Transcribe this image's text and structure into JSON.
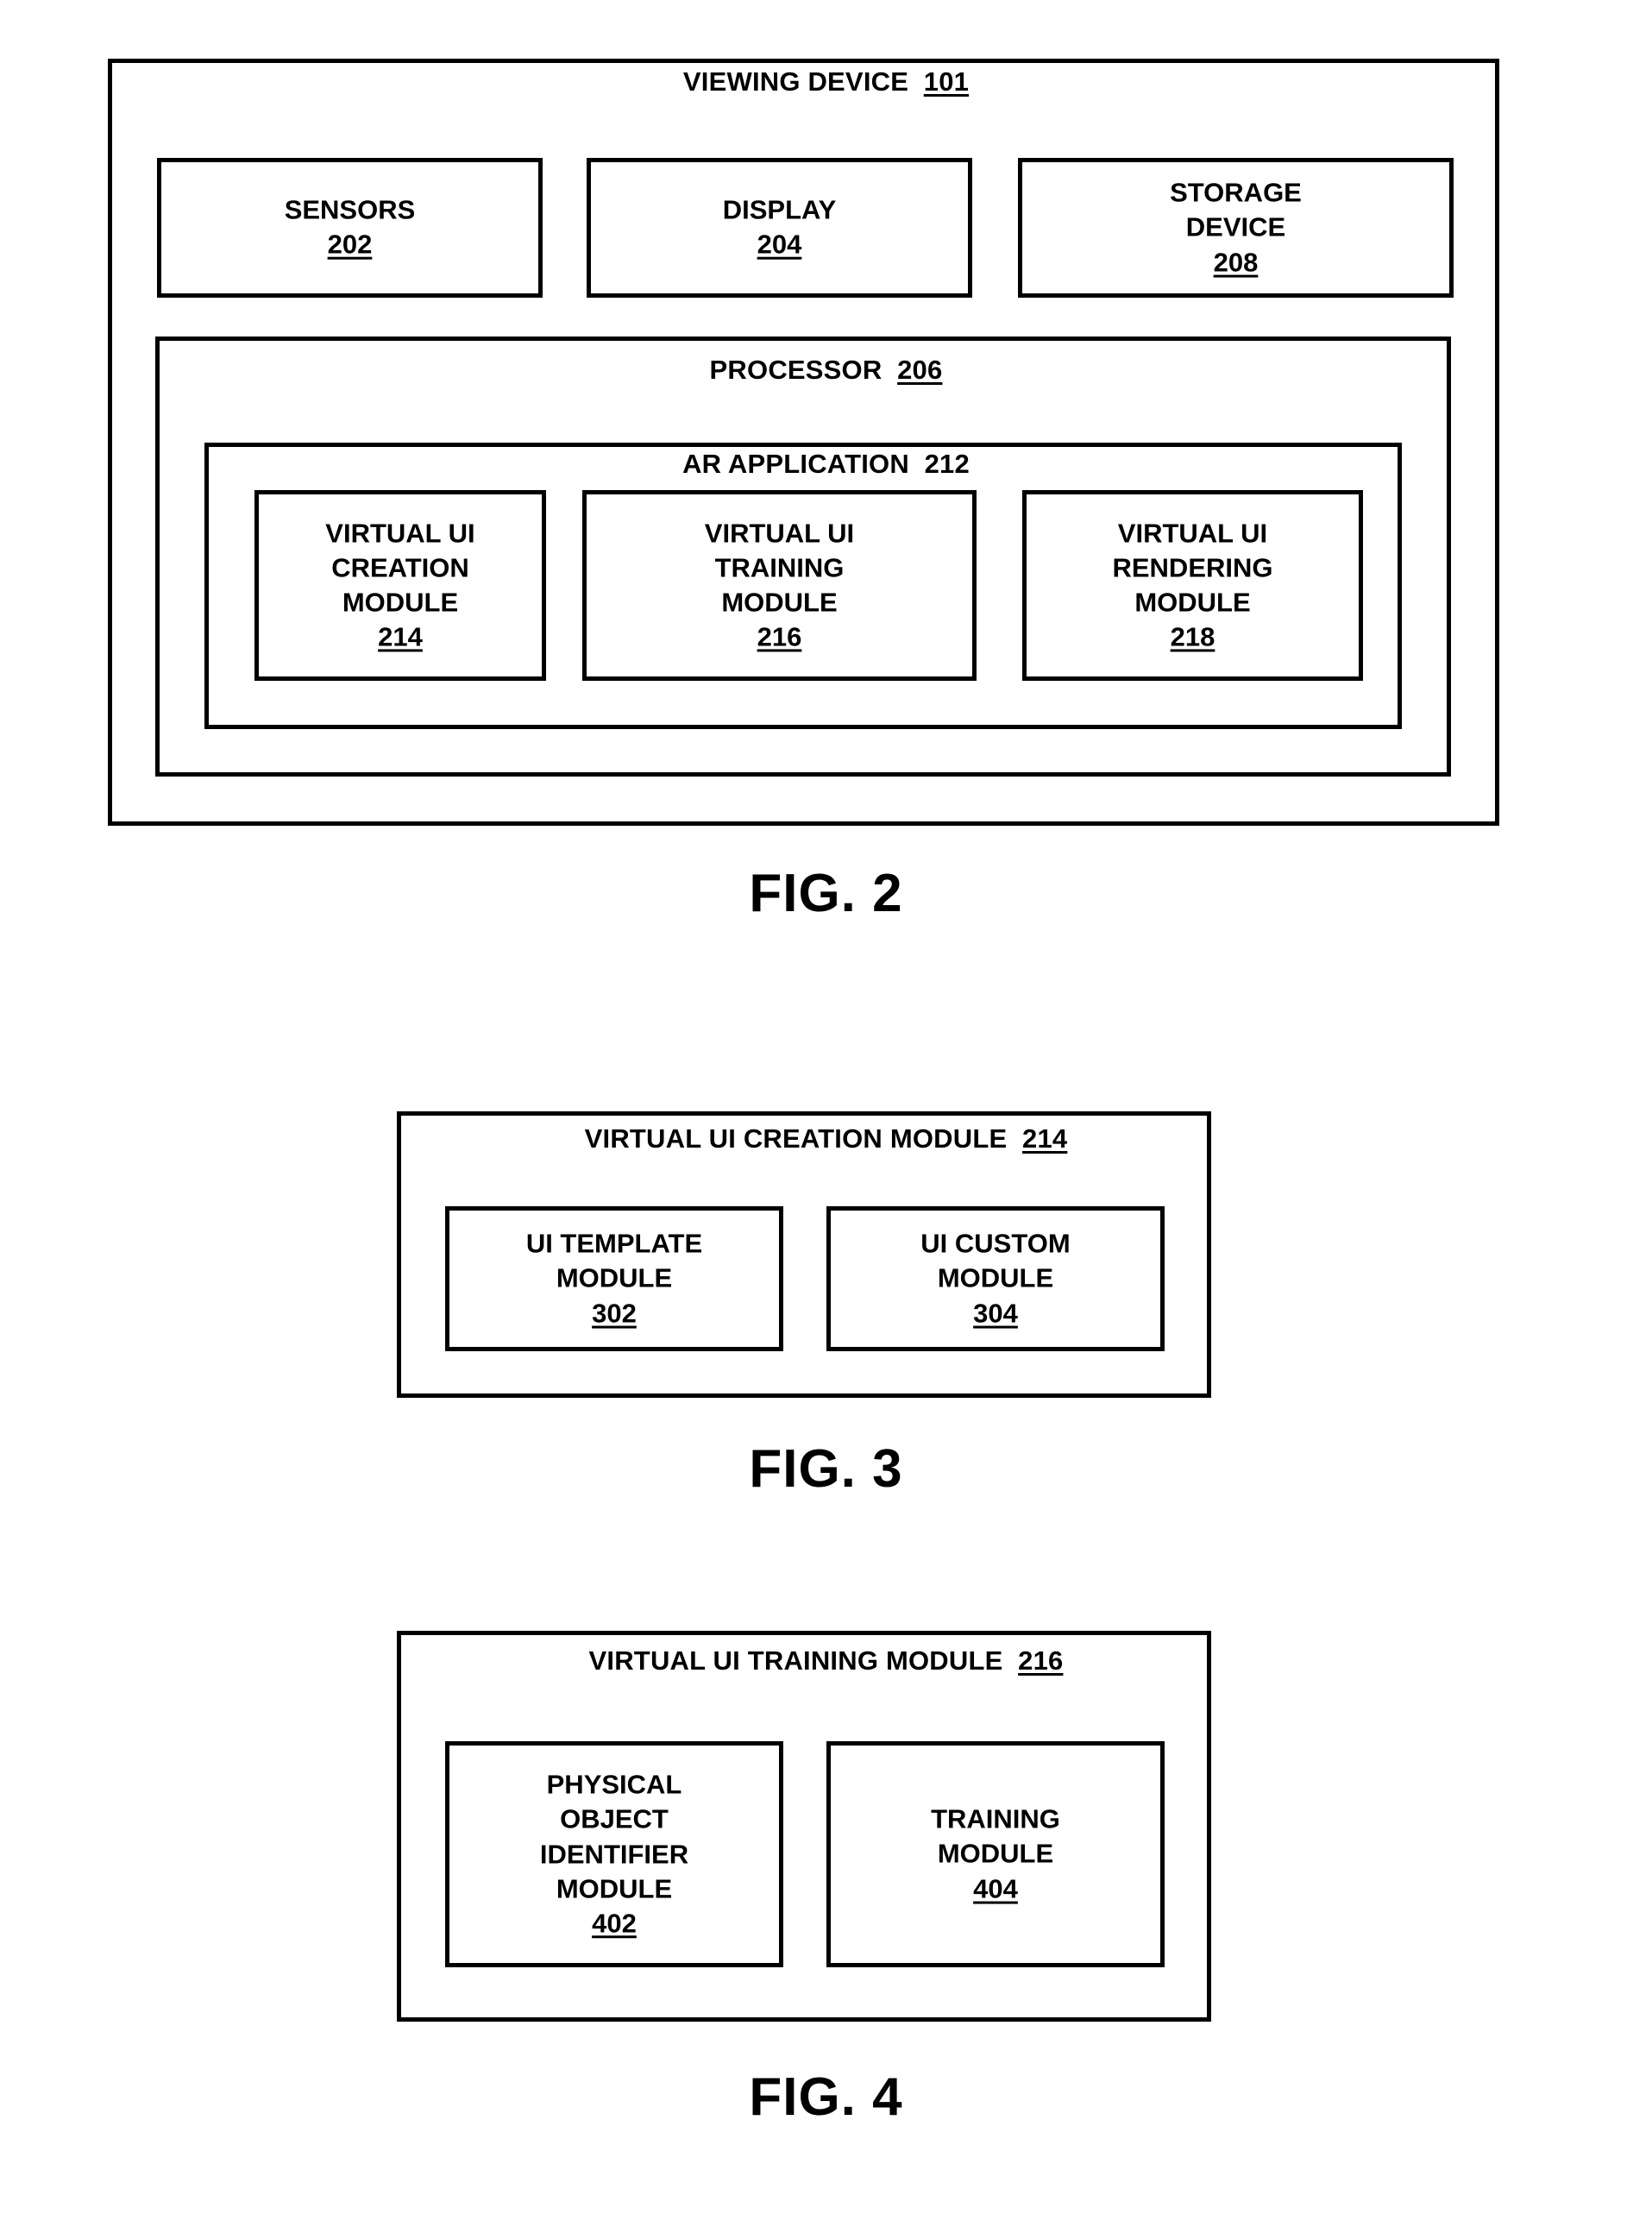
{
  "figures": [
    {
      "caption": "FIG. 2",
      "outer": {
        "title": "VIEWING DEVICE",
        "numeral": "101"
      },
      "components": [
        {
          "label": "SENSORS",
          "numeral": "202"
        },
        {
          "label": "DISPLAY",
          "numeral": "204"
        },
        {
          "label_line1": "STORAGE",
          "label_line2": "DEVICE",
          "numeral": "208"
        }
      ],
      "processor": {
        "title": "PROCESSOR",
        "numeral": "206"
      },
      "ar_application": {
        "title": "AR APPLICATION",
        "numeral": "212",
        "numeral_underlined": false
      },
      "modules": [
        {
          "line1": "VIRTUAL UI",
          "line2": "CREATION",
          "line3": "MODULE",
          "numeral": "214"
        },
        {
          "line1": "VIRTUAL UI",
          "line2": "TRAINING",
          "line3": "MODULE",
          "numeral": "216"
        },
        {
          "line1": "VIRTUAL UI",
          "line2": "RENDERING",
          "line3": "MODULE",
          "numeral": "218"
        }
      ]
    },
    {
      "caption": "FIG. 3",
      "outer": {
        "title": "VIRTUAL UI CREATION MODULE",
        "numeral": "214"
      },
      "modules": [
        {
          "line1": "UI TEMPLATE",
          "line2": "MODULE",
          "numeral": "302"
        },
        {
          "line1": "UI CUSTOM",
          "line2": "MODULE",
          "numeral": "304"
        }
      ]
    },
    {
      "caption": "FIG. 4",
      "outer": {
        "title": "VIRTUAL UI TRAINING MODULE",
        "numeral": "216"
      },
      "modules": [
        {
          "line1": "PHYSICAL",
          "line2": "OBJECT",
          "line3": "IDENTIFIER",
          "line4": "MODULE",
          "numeral": "402"
        },
        {
          "line1": "TRAINING",
          "line2": "MODULE",
          "numeral": "404"
        }
      ]
    }
  ],
  "colors": {
    "ink": "#000000",
    "paper": "#ffffff"
  }
}
